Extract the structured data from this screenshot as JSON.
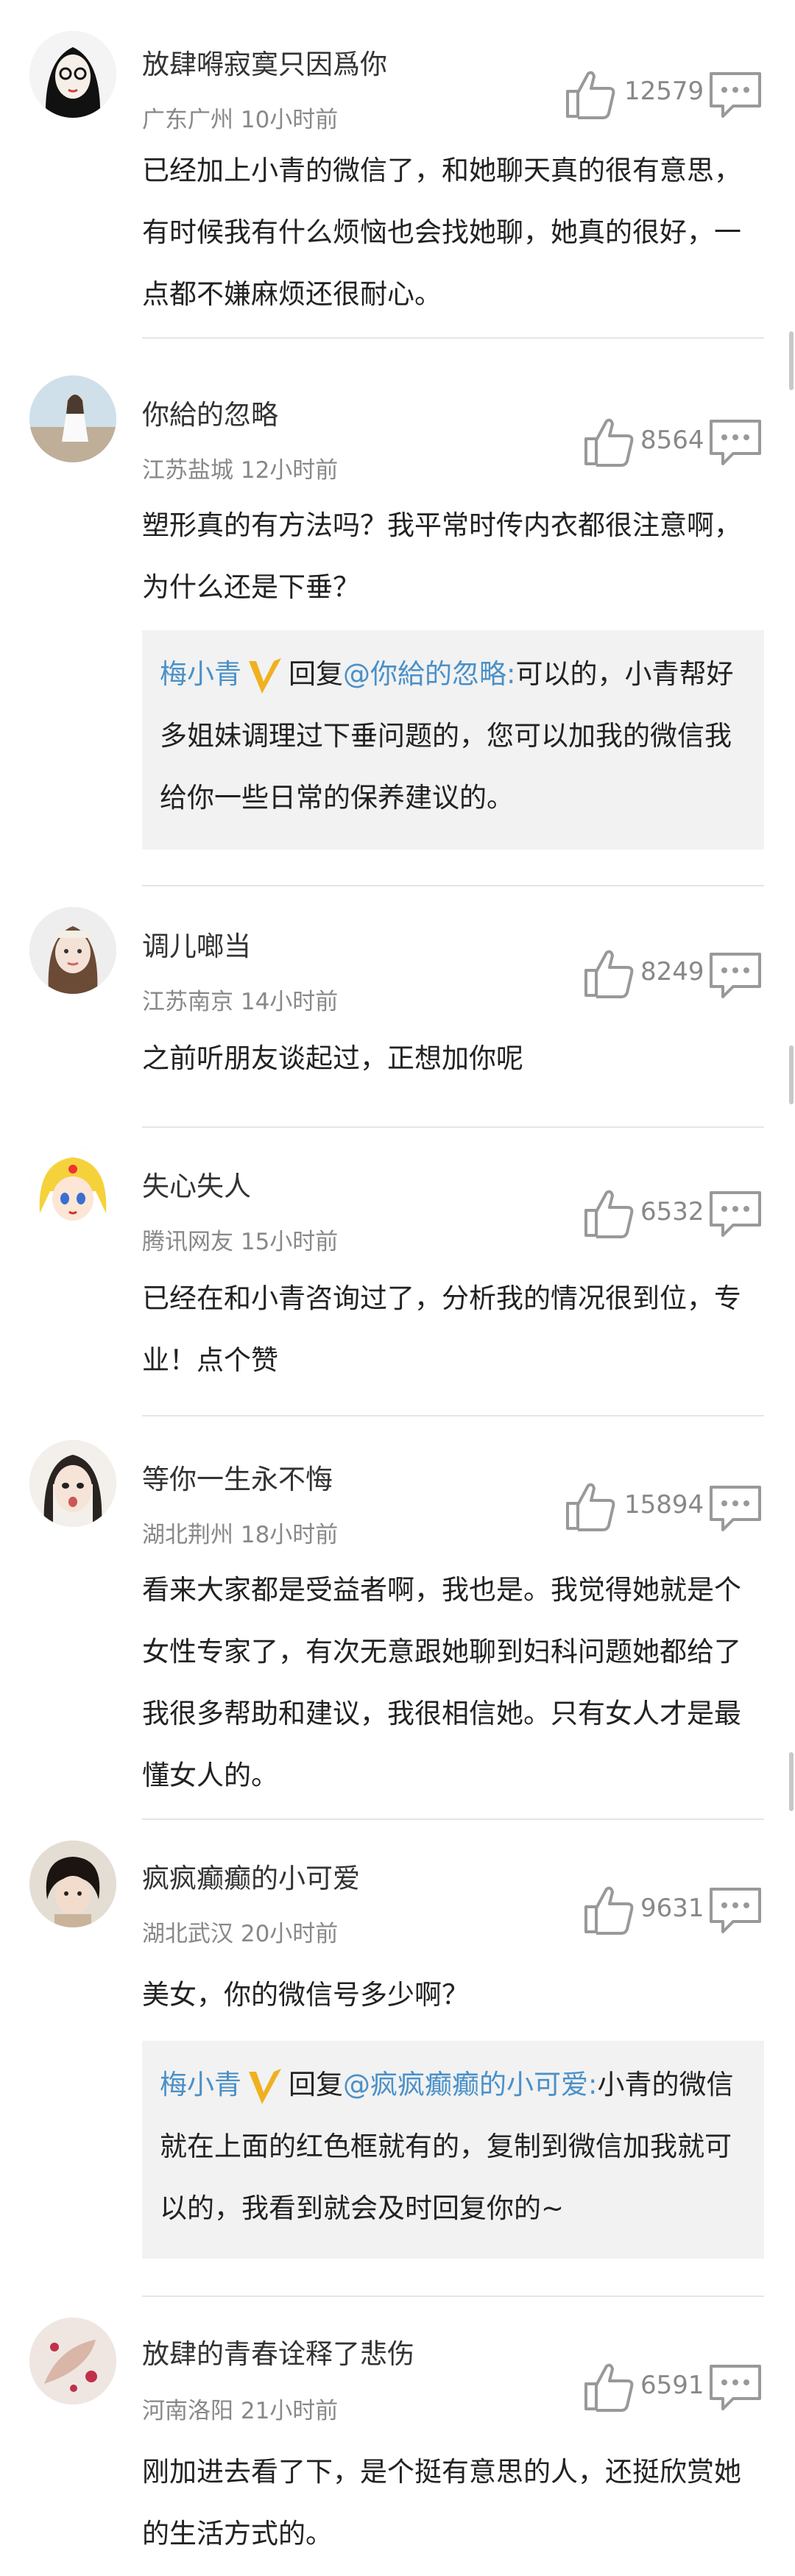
{
  "comments": [
    {
      "name": "放肆嘚寂寞只因爲你",
      "location": "广东广州",
      "time": "10小时前",
      "likes": "12579",
      "text": "已经加上小青的微信了，和她聊天真的很有意思，有时候我有什么烦恼也会找她聊，她真的很好，一点都不嫌麻烦还很耐心。"
    },
    {
      "name": "你給的忽略",
      "location": "江苏盐城",
      "time": "12小时前",
      "likes": "8564",
      "text": "塑形真的有方法吗？我平常时传内衣都很注意啊，为什么还是下垂？",
      "reply": {
        "author": "梅小青",
        "prefix": "回复",
        "target": "@你給的忽略:",
        "text": "可以的，小青帮好 多姐妹调理过下垂问题的，您可以加我的微信我给你一些日常的保养建议的。"
      }
    },
    {
      "name": "调儿啷当",
      "location": "江苏南京",
      "time": "14小时前",
      "likes": "8249",
      "text": "之前听朋友谈起过，正想加你呢"
    },
    {
      "name": "失心失人",
      "location": "腾讯网友",
      "time": "15小时前",
      "likes": "6532",
      "text": "已经在和小青咨询过了，分析我的情况很到位，专业！点个赞"
    },
    {
      "name": "等你一生永不悔",
      "location": "湖北荆州",
      "time": "18小时前",
      "likes": "15894",
      "text": "看来大家都是受益者啊，我也是。我觉得她就是个女性专家了，有次无意跟她聊到妇科问题她都给了我很多帮助和建议，我很相信她。只有女人才是最懂女人的。"
    },
    {
      "name": "疯疯癫癫的小可爱",
      "location": "湖北武汉",
      "time": "20小时前",
      "likes": "9631",
      "text": "美女，你的微信号多少啊？",
      "reply": {
        "author": "梅小青",
        "prefix": "回复",
        "target": "@疯疯癫癫的小可爱:",
        "text": "小青的微信就在上面的红色框就有的，复制到微信加我就可以的，我看到就会及时回复你的~"
      }
    },
    {
      "name": "放肆的青春诠释了悲伤",
      "location": "河南洛阳",
      "time": "21小时前",
      "likes": "6591",
      "text": "刚加进去看了下，是个挺有意思的人，还挺欣赏她的生活方式的。"
    }
  ],
  "icons": {
    "like": "thumbs-up-icon",
    "reply": "comment-bubble-icon",
    "badge": "verified-v-icon"
  },
  "colors": {
    "accent": "#4a90c8",
    "badge": "#f0b020",
    "reply_bg": "#f2f2f2"
  }
}
